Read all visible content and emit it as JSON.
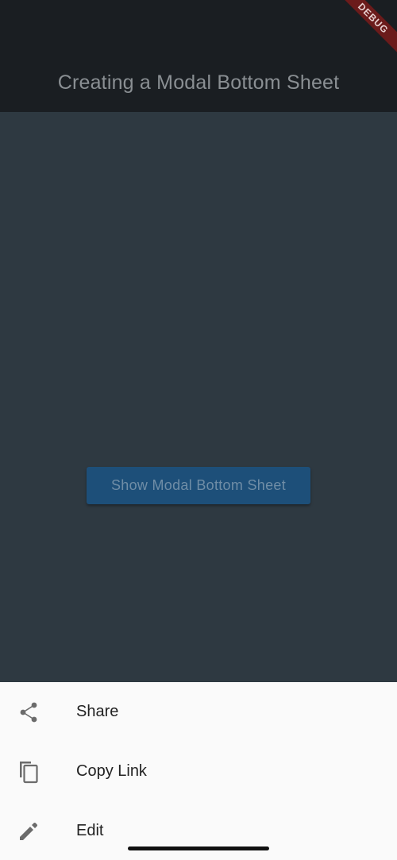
{
  "app_bar": {
    "title": "Creating a Modal Bottom Sheet"
  },
  "debug_banner": {
    "label": "DEBUG"
  },
  "main": {
    "button_label": "Show Modal Bottom Sheet"
  },
  "bottom_sheet": {
    "items": [
      {
        "label": "Share",
        "icon": "share-icon"
      },
      {
        "label": "Copy Link",
        "icon": "copy-icon"
      },
      {
        "label": "Edit",
        "icon": "pencil-icon"
      }
    ]
  },
  "colors": {
    "app_bar_bg": "#1a1e22",
    "scrim_bg": "#2e3941",
    "button_bg": "#1d4f79",
    "sheet_bg": "#fafafa"
  }
}
